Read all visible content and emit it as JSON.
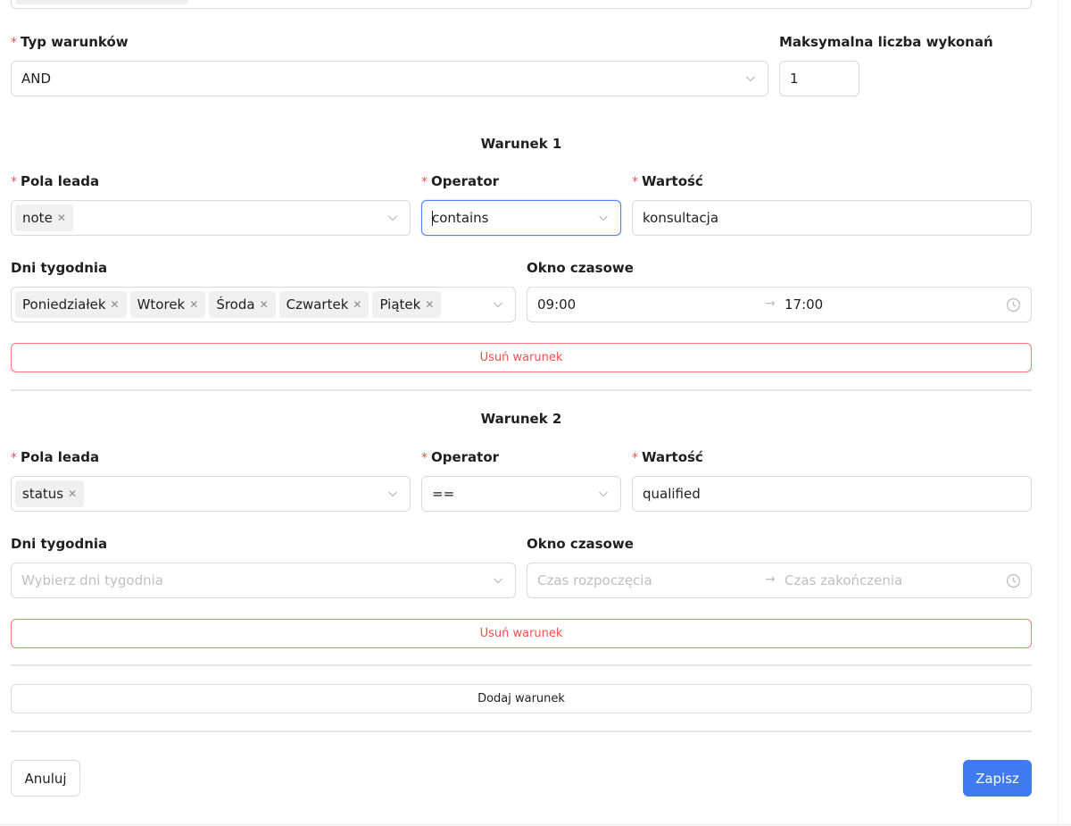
{
  "conditions_type": {
    "label": "Typ warunków",
    "value": "AND"
  },
  "max_runs": {
    "label": "Maksymalna liczba wykonań",
    "value": "1"
  },
  "conditions": [
    {
      "title": "Warunek 1",
      "lead_fields_label": "Pola leada",
      "lead_fields": [
        "note"
      ],
      "operator_label": "Operator",
      "operator": "contains",
      "value_label": "Wartość",
      "value": "konsultacja",
      "days_label": "Dni tygodnia",
      "days": [
        "Poniedziałek",
        "Wtorek",
        "Środa",
        "Czwartek",
        "Piątek"
      ],
      "days_placeholder": "",
      "time_label": "Okno czasowe",
      "time_start": "09:00",
      "time_end": "17:00",
      "remove_label": "Usuń warunek"
    },
    {
      "title": "Warunek 2",
      "lead_fields_label": "Pola leada",
      "lead_fields": [
        "status"
      ],
      "operator_label": "Operator",
      "operator": "==",
      "value_label": "Wartość",
      "value": "qualified",
      "days_label": "Dni tygodnia",
      "days": [],
      "days_placeholder": "Wybierz dni tygodnia",
      "time_label": "Okno czasowe",
      "time_start_placeholder": "Czas rozpoczęcia",
      "time_end_placeholder": "Czas zakończenia",
      "remove_label": "Usuń warunek"
    }
  ],
  "add_condition_label": "Dodaj warunek",
  "cancel_label": "Anuluj",
  "save_label": "Zapisz",
  "colors": {
    "primary": "#3f7af2",
    "danger": "#ff4d4f",
    "focus": "#4f7ff2"
  }
}
